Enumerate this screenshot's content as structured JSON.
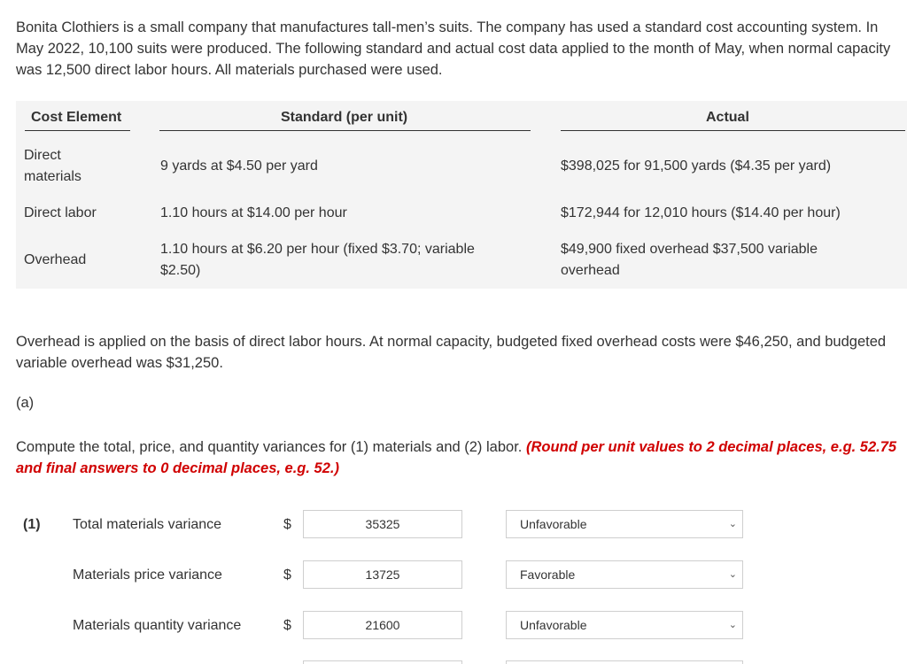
{
  "intro": "Bonita Clothiers is a small company that manufactures tall-men’s suits. The company has used a standard cost accounting system. In May 2022, 10,100 suits were produced. The following standard and actual cost data applied to the month of May, when normal capacity was 12,500 direct labor hours. All materials purchased were used.",
  "table": {
    "headers": {
      "cost_element": "Cost Element",
      "standard": "Standard (per unit)",
      "actual": "Actual"
    },
    "rows": [
      {
        "element": "Direct materials",
        "standard": "9 yards at $4.50 per yard",
        "actual": "$398,025 for 91,500 yards ($4.35 per yard)"
      },
      {
        "element": "Direct labor",
        "standard": "1.10 hours at $14.00 per hour",
        "actual": "$172,944 for 12,010 hours ($14.40 per hour)"
      },
      {
        "element": "Overhead",
        "standard": "1.10 hours at $6.20 per hour (fixed $3.70; variable $2.50)",
        "actual": "$49,900 fixed overhead $37,500 variable overhead"
      }
    ]
  },
  "note": "Overhead is applied on the basis of direct labor hours. At normal capacity, budgeted fixed overhead costs were $46,250, and budgeted variable overhead was $31,250.",
  "part_label": "(a)",
  "instruction": {
    "text": "Compute the total, price, and quantity variances for (1) materials and (2) labor.",
    "emphasis": "(Round per unit values to 2 decimal places, e.g. 52.75 and final answers to 0 decimal places, e.g. 52.)"
  },
  "section_number": "(1)",
  "currency_symbol": "$",
  "variances": [
    {
      "label": "Total materials variance",
      "value": "35325",
      "type": "Unfavorable"
    },
    {
      "label": "Materials price variance",
      "value": "13725",
      "type": "Favorable"
    },
    {
      "label": "Materials quantity variance",
      "value": "21600",
      "type": "Unfavorable"
    }
  ],
  "icons": {
    "dropdown": "chevron-down-icon"
  },
  "colors": {
    "emphasis": "#d00000",
    "table_bg": "#f4f4f4"
  }
}
